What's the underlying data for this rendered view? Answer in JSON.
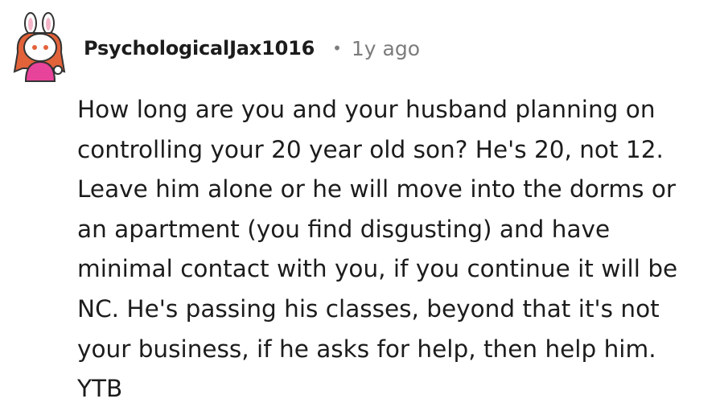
{
  "comment": {
    "author": "PsychologicalJax1016",
    "separator": "•",
    "age": "1y ago",
    "avatar_icon": "snoo-bunny-avatar-icon",
    "body": "How long are you and your husband planning on\ncontrolling your 20 year old son? He's 20, not 12.\nLeave him alone or he will move into the dorms or\nan apartment (you find disgusting) and have\nminimal contact with you, if you continue it will be\nNC. He's passing his classes, beyond that it's not\nyour business, if he asks for help, then help him.\nYTB"
  },
  "colors": {
    "text": "#1c1c1c",
    "meta": "#7c7c7c",
    "avatar_hair": "#e2623a",
    "avatar_shirt": "#e8439a"
  }
}
